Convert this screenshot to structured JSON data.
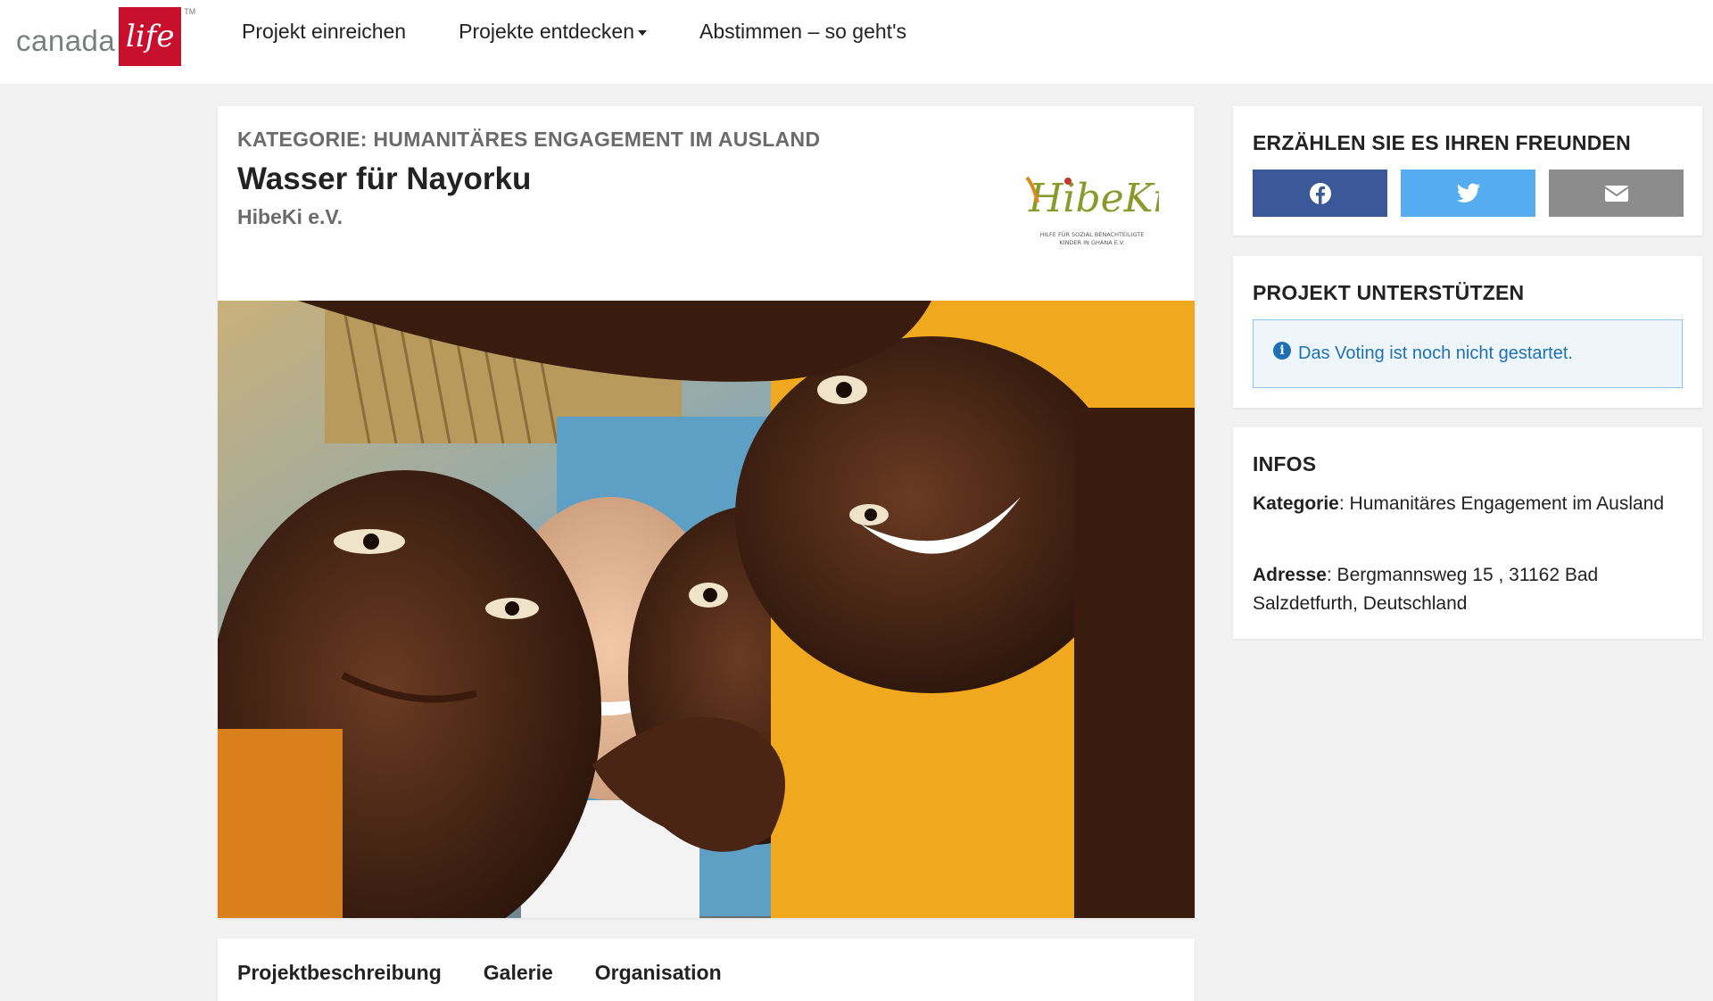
{
  "brand": {
    "logo_word": "canada",
    "logo_script": "life",
    "logo_tm": "TM"
  },
  "nav": {
    "items": [
      {
        "label": "Projekt einreichen",
        "has_dropdown": false
      },
      {
        "label": "Projekte entdecken",
        "has_dropdown": true
      },
      {
        "label": "Abstimmen – so geht's",
        "has_dropdown": false
      }
    ]
  },
  "project": {
    "category": "KATEGORIE: HUMANITÄRES ENGAGEMENT IM AUSLAND",
    "title": "Wasser für Nayorku",
    "organization": "HibeKi e.V.",
    "org_logo": {
      "name": "HibeKi",
      "tagline_1": "HILFE FÜR SOZIAL BENACHTEILIGTE",
      "tagline_2": "KINDER IN GHANA E.V."
    }
  },
  "tabs": [
    {
      "label": "Projektbeschreibung"
    },
    {
      "label": "Galerie"
    },
    {
      "label": "Organisation"
    }
  ],
  "share": {
    "title": "ERZÄHLEN SIE ES IHREN FREUNDEN",
    "buttons": [
      {
        "icon": "facebook-icon",
        "color": "#3b5998"
      },
      {
        "icon": "twitter-icon",
        "color": "#55acee"
      },
      {
        "icon": "email-icon",
        "color": "#8c8c8c"
      }
    ]
  },
  "support": {
    "title": "PROJEKT UNTERSTÜTZEN",
    "alert_text": "Das Voting ist noch nicht gestartet."
  },
  "infos": {
    "title": "INFOS",
    "category_label": "Kategorie",
    "category_value": ": Humanitäres Engagement im Ausland",
    "address_label": "Adresse",
    "address_value": ": Bergmannsweg 15 , 31162 Bad Salzdetfurth, Deutschland"
  },
  "colors": {
    "brand_red": "#c8102e",
    "info_blue": "#1f6fb5",
    "facebook": "#3b5998",
    "twitter": "#55acee",
    "email": "#8c8c8c"
  }
}
